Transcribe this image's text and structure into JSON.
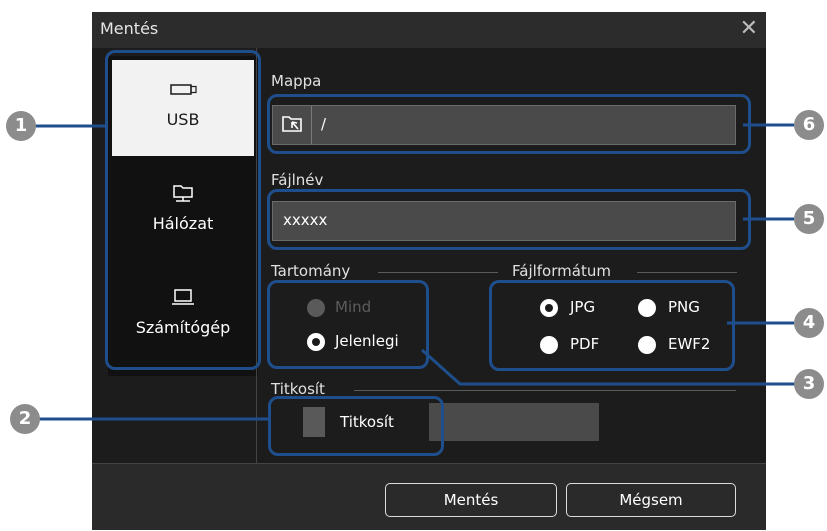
{
  "dialog": {
    "title": "Mentés",
    "close_label": "✕"
  },
  "sidebar": {
    "items": [
      {
        "label": "USB",
        "icon": "usb-icon",
        "active": true
      },
      {
        "label": "Hálózat",
        "icon": "network-folder-icon",
        "active": false
      },
      {
        "label": "Számítógép",
        "icon": "laptop-icon",
        "active": false
      }
    ]
  },
  "folder": {
    "label": "Mappa",
    "value": "/"
  },
  "filename": {
    "label": "Fájlnév",
    "value": "xxxxx"
  },
  "range": {
    "label": "Tartomány",
    "options": [
      "Mind",
      "Jelenlegi"
    ],
    "selected": "Jelenlegi",
    "disabled": [
      "Mind"
    ]
  },
  "format": {
    "label": "Fájlformátum",
    "options": [
      "JPG",
      "PNG",
      "PDF",
      "EWF2"
    ],
    "selected": "JPG"
  },
  "encrypt": {
    "label": "Titkosít",
    "checkbox_label": "Titkosít",
    "checked": false
  },
  "footer": {
    "save_label": "Mentés",
    "cancel_label": "Mégsem"
  },
  "callouts": [
    "1",
    "2",
    "3",
    "4",
    "5",
    "6"
  ],
  "colors": {
    "callout_border": "#1f4e8c",
    "badge": "#8c8c8c",
    "dialog_bg": "#1c1c1c"
  }
}
